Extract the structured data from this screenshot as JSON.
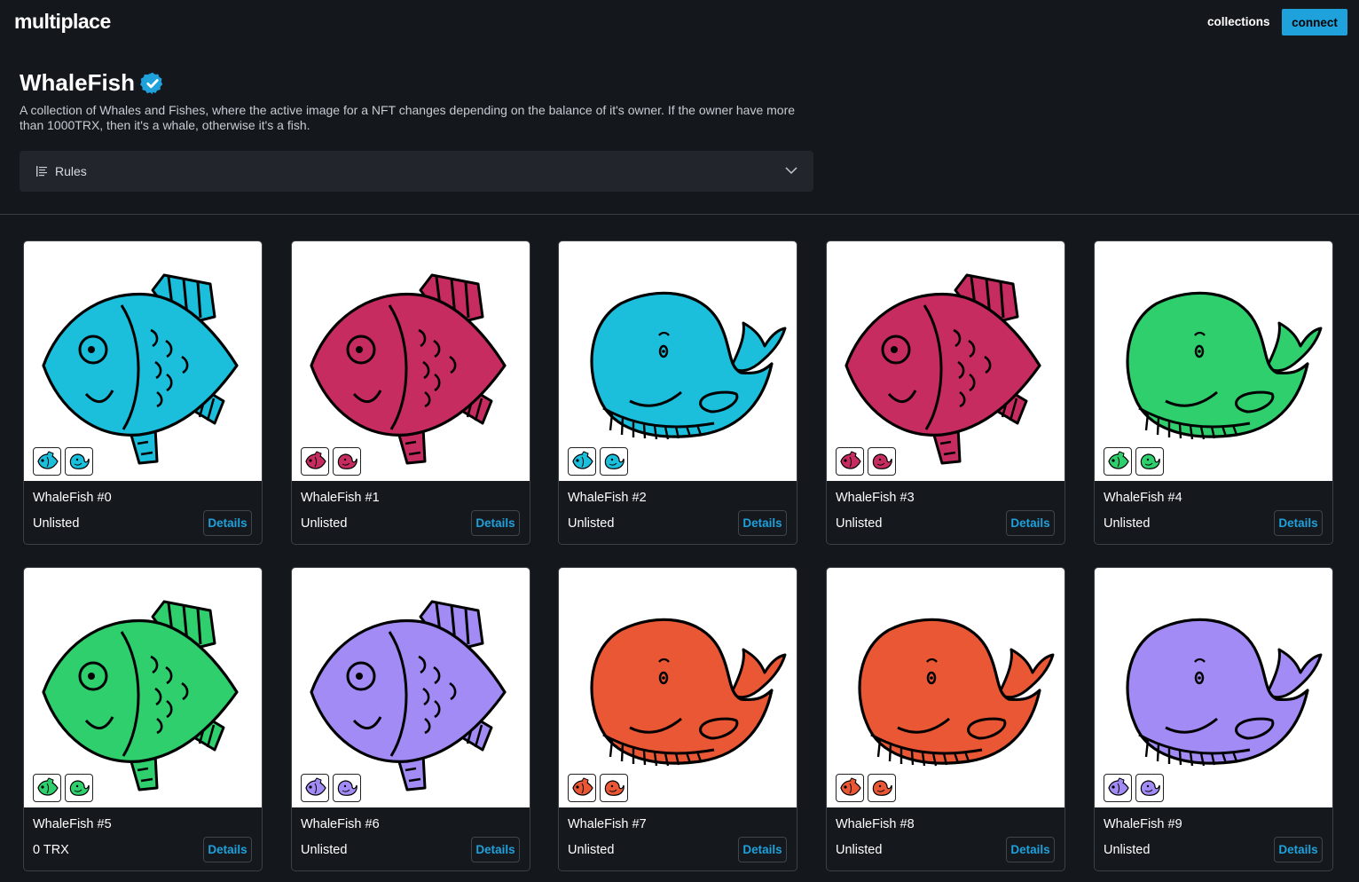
{
  "header": {
    "logo": "multiplace",
    "nav_collections": "collections",
    "connect_label": "connect"
  },
  "collection": {
    "title": "WhaleFish",
    "verified_icon": "verified-badge-icon",
    "description": "A collection of Whales and Fishes, where the active image for a NFT changes depending on the balance of it's owner. If the owner have more than 1000TRX, then it's a whale, otherwise it's a fish.",
    "rules_label": "Rules"
  },
  "colors": {
    "accent": "#1fa1dc",
    "background": "#14171c",
    "cyan": "#1bbfdc",
    "magenta": "#c72c61",
    "green": "#2ecf6c",
    "purple": "#a38bf5",
    "orange": "#ea5735"
  },
  "nfts": [
    {
      "name": "WhaleFish #0",
      "price": "Unlisted",
      "details": "Details",
      "image": "fish",
      "color": "#1bbfdc"
    },
    {
      "name": "WhaleFish #1",
      "price": "Unlisted",
      "details": "Details",
      "image": "fish",
      "color": "#c72c61"
    },
    {
      "name": "WhaleFish #2",
      "price": "Unlisted",
      "details": "Details",
      "image": "whale",
      "color": "#1bbfdc"
    },
    {
      "name": "WhaleFish #3",
      "price": "Unlisted",
      "details": "Details",
      "image": "fish",
      "color": "#c72c61"
    },
    {
      "name": "WhaleFish #4",
      "price": "Unlisted",
      "details": "Details",
      "image": "whale",
      "color": "#2ecf6c"
    },
    {
      "name": "WhaleFish #5",
      "price": "0 TRX",
      "details": "Details",
      "image": "fish",
      "color": "#2ecf6c"
    },
    {
      "name": "WhaleFish #6",
      "price": "Unlisted",
      "details": "Details",
      "image": "fish",
      "color": "#a38bf5"
    },
    {
      "name": "WhaleFish #7",
      "price": "Unlisted",
      "details": "Details",
      "image": "whale",
      "color": "#ea5735"
    },
    {
      "name": "WhaleFish #8",
      "price": "Unlisted",
      "details": "Details",
      "image": "whale",
      "color": "#ea5735"
    },
    {
      "name": "WhaleFish #9",
      "price": "Unlisted",
      "details": "Details",
      "image": "whale",
      "color": "#a38bf5"
    }
  ]
}
